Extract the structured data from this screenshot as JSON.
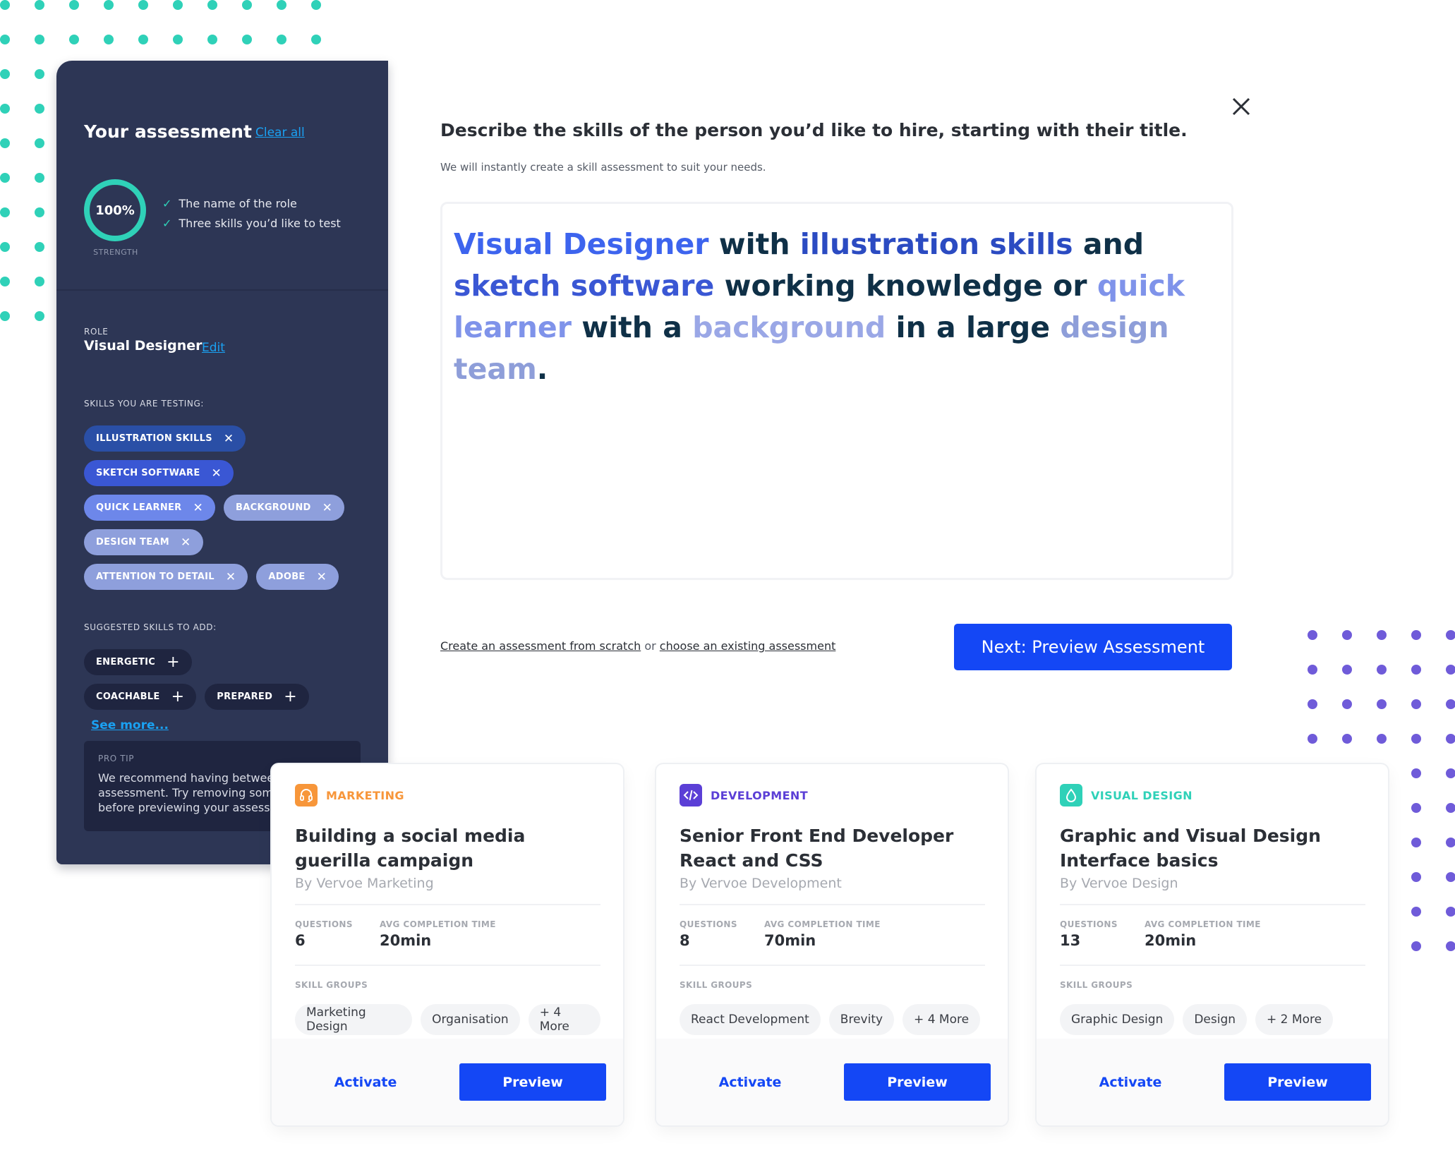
{
  "colors": {
    "accent": "#1447f5",
    "sidebar_bg": "#2d3655",
    "teal": "#2fd1b8",
    "purple": "#6f5bd9",
    "link": "#1aa1f2"
  },
  "sidebar": {
    "title": "Your assessment",
    "clear_all": "Clear all",
    "strength": {
      "value": "100%",
      "percent": 100,
      "label": "STRENGTH"
    },
    "checklist": [
      "The name of the role",
      "Three skills you’d like to test"
    ],
    "role_label": "ROLE",
    "role_name": "Visual Designer",
    "edit_label": "Edit",
    "skills_label": "SKILLS YOU ARE TESTING:",
    "skills": [
      {
        "label": "ILLUSTRATION SKILLS",
        "color": "#2a4fa6"
      },
      {
        "label": "SKETCH SOFTWARE",
        "color": "#3a57d4"
      },
      {
        "label": "QUICK LEARNER",
        "color": "#6d87ea"
      },
      {
        "label": "BACKGROUND",
        "color": "#8e9fdc"
      },
      {
        "label": "DESIGN TEAM",
        "color": "#8e9fdc"
      },
      {
        "label": "ATTENTION TO DETAIL",
        "color": "#8e9fdc"
      },
      {
        "label": "ADOBE",
        "color": "#8e9fdc"
      }
    ],
    "suggested_label": "SUGGESTED SKILLS TO ADD:",
    "suggested": [
      "ENERGETIC",
      "COACHABLE",
      "PREPARED"
    ],
    "see_more": "See more...",
    "pro_tip": {
      "label": "PRO TIP",
      "lines": [
        "We recommend having between",
        "assessment. Try removing some",
        "before previewing your assessm"
      ]
    }
  },
  "main": {
    "heading": "Describe the skills of the person you’d like to hire, starting with their title.",
    "subheading": "We will instantly create a skill assessment to suit your needs.",
    "description": [
      {
        "text": "Visual Designer",
        "style": "t-c1"
      },
      {
        "text": " with ",
        "style": ""
      },
      {
        "text": "illustration skills",
        "style": "t-c2"
      },
      {
        "text": " and ",
        "style": ""
      },
      {
        "text": "sketch software",
        "style": "t-c3"
      },
      {
        "text": " working knowledge or ",
        "style": ""
      },
      {
        "text": "quick learner",
        "style": "t-c4"
      },
      {
        "text": " with a ",
        "style": ""
      },
      {
        "text": "background",
        "style": "t-c5"
      },
      {
        "text": " in a large ",
        "style": ""
      },
      {
        "text": "design team",
        "style": "t-c6"
      },
      {
        "text": ".",
        "style": ""
      }
    ],
    "scratch_link": "Create an assessment from scratch",
    "or_text": " or ",
    "existing_link": "choose an existing assessment",
    "next_button": "Next: Preview Assessment"
  },
  "cards": [
    {
      "category": "MARKETING",
      "category_color": "#f7963a",
      "icon": "headset-icon",
      "title": "Building a social media guerilla campaign",
      "by": "By Vervoe Marketing",
      "questions_label": "QUESTIONS",
      "questions": "6",
      "time_label": "AVG COMPLETION TIME",
      "time": "20min",
      "skill_groups_label": "SKILL GROUPS",
      "skill_groups": [
        "Marketing Design",
        "Organisation",
        "+ 4 More"
      ],
      "activate": "Activate",
      "preview": "Preview"
    },
    {
      "category": "DEVELOPMENT",
      "category_color": "#5b3fd6",
      "icon": "code-icon",
      "title": "Senior Front End Developer React and CSS",
      "by": "By Vervoe Development",
      "questions_label": "QUESTIONS",
      "questions": "8",
      "time_label": "AVG COMPLETION TIME",
      "time": "70min",
      "skill_groups_label": "SKILL GROUPS",
      "skill_groups": [
        "React Development",
        "Brevity",
        "+ 4 More"
      ],
      "activate": "Activate",
      "preview": "Preview"
    },
    {
      "category": "VISUAL DESIGN",
      "category_color": "#2fd1b8",
      "icon": "droplet-icon",
      "title": "Graphic and Visual Design Interface basics",
      "by": "By Vervoe Design",
      "questions_label": "QUESTIONS",
      "questions": "13",
      "time_label": "AVG COMPLETION TIME",
      "time": "20min",
      "skill_groups_label": "SKILL GROUPS",
      "skill_groups": [
        "Graphic Design",
        "Design",
        "+ 2 More"
      ],
      "activate": "Activate",
      "preview": "Preview"
    }
  ]
}
